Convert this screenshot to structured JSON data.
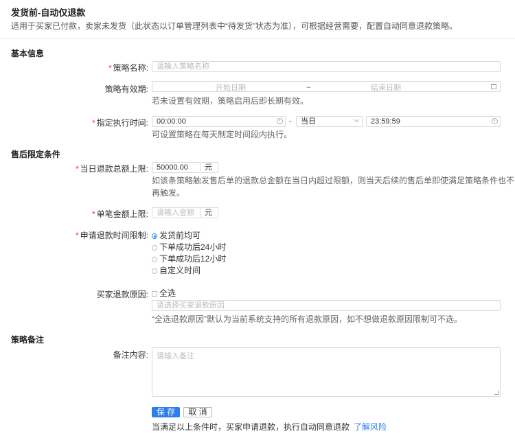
{
  "header": {
    "title": "发货前-自动仅退款",
    "description": "适用于买家已付款，卖家未发货（此状态以订单管理列表中“待发货”状态为准），可根据经营需要，配置自动同意退款策略。"
  },
  "basic": {
    "section_title": "基本信息",
    "name_label": "策略名称:",
    "name_placeholder": "请输入策略名称",
    "validity_label": "策略有效期:",
    "start_placeholder": "开始日期",
    "range_sep": "~",
    "end_placeholder": "结束日期",
    "validity_hint": "若未设置有效期，策略启用后即长期有效。",
    "exec_label": "指定执行时间:",
    "exec_start": "00:00:00",
    "exec_dash": "-",
    "exec_day": "当日",
    "exec_end": "23:59:59",
    "exec_hint": "可设置策略在每天制定时间段内执行。"
  },
  "limits": {
    "section_title": "售后限定条件",
    "daily_label": "当日退款总额上限:",
    "daily_value": "50000.00",
    "daily_unit": "元",
    "daily_hint_1": "如该条策略触发售后单的退款总金额在当日内超过限额，则当天后续的售后单即使满足策略条件也不",
    "daily_hint_2": "再触发。",
    "single_label": "单笔金额上限:",
    "single_placeholder": "请输入金额",
    "single_unit": "元",
    "time_label": "申请退款时间限制:",
    "time_options": [
      "发货前均可",
      "下单成功后24小时",
      "下单成功后12小时",
      "自定义时间"
    ],
    "reason_label": "买家退款原因:",
    "reason_select_all": "全选",
    "reason_placeholder": "请选择买家退款原因",
    "reason_hint": "“全选退款原因”默认为当前系统支持的所有退款原因，如不想做退款原因限制可不选。"
  },
  "notes": {
    "section_title": "策略备注",
    "label": "备注内容:",
    "placeholder": "请输入备注"
  },
  "actions": {
    "save": "保 存",
    "cancel": "取 消",
    "footer_text": "当满足以上条件时，买家申请退款，执行自动同意退款",
    "footer_link": "了解风险"
  },
  "colors": {
    "accent": "#2d7ee8",
    "required": "#e4393c"
  }
}
